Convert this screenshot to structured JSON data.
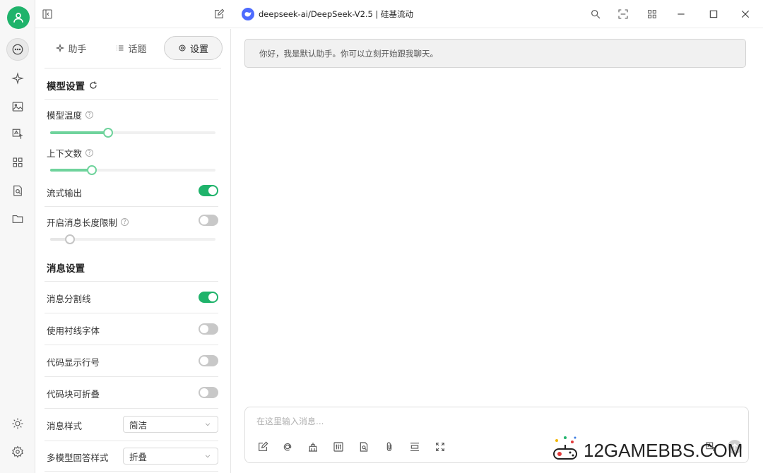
{
  "header": {
    "model_title": "deepseek-ai/DeepSeek-V2.5 | 硅基流动"
  },
  "tabs": [
    {
      "label": "助手"
    },
    {
      "label": "话题"
    },
    {
      "label": "设置"
    }
  ],
  "model_settings": {
    "title": "模型设置",
    "temperature_label": "模型温度",
    "temperature_value": 0.35,
    "context_label": "上下文数",
    "context_value": 0.25,
    "stream_label": "流式输出",
    "stream_on": true,
    "max_length_label": "开启消息长度限制",
    "max_length_on": false,
    "max_length_value": 0.12
  },
  "message_settings": {
    "title": "消息设置",
    "divider_label": "消息分割线",
    "divider_on": true,
    "serif_label": "使用衬线字体",
    "serif_on": false,
    "line_numbers_label": "代码显示行号",
    "line_numbers_on": false,
    "collapsible_label": "代码块可折叠",
    "collapsible_on": false,
    "style_label": "消息样式",
    "style_value": "简洁",
    "multi_model_label": "多模型回答样式",
    "multi_model_value": "折叠"
  },
  "chat": {
    "greeting": "你好，我是默认助手。你可以立刻开始跟我聊天。",
    "input_placeholder": "在这里输入消息..."
  },
  "watermark": {
    "text": "12GAMEBBS.COM"
  },
  "colors": {
    "accent": "#1fb36b",
    "slider_fill": "#6fd39c",
    "model_logo": "#4d6bfe"
  }
}
